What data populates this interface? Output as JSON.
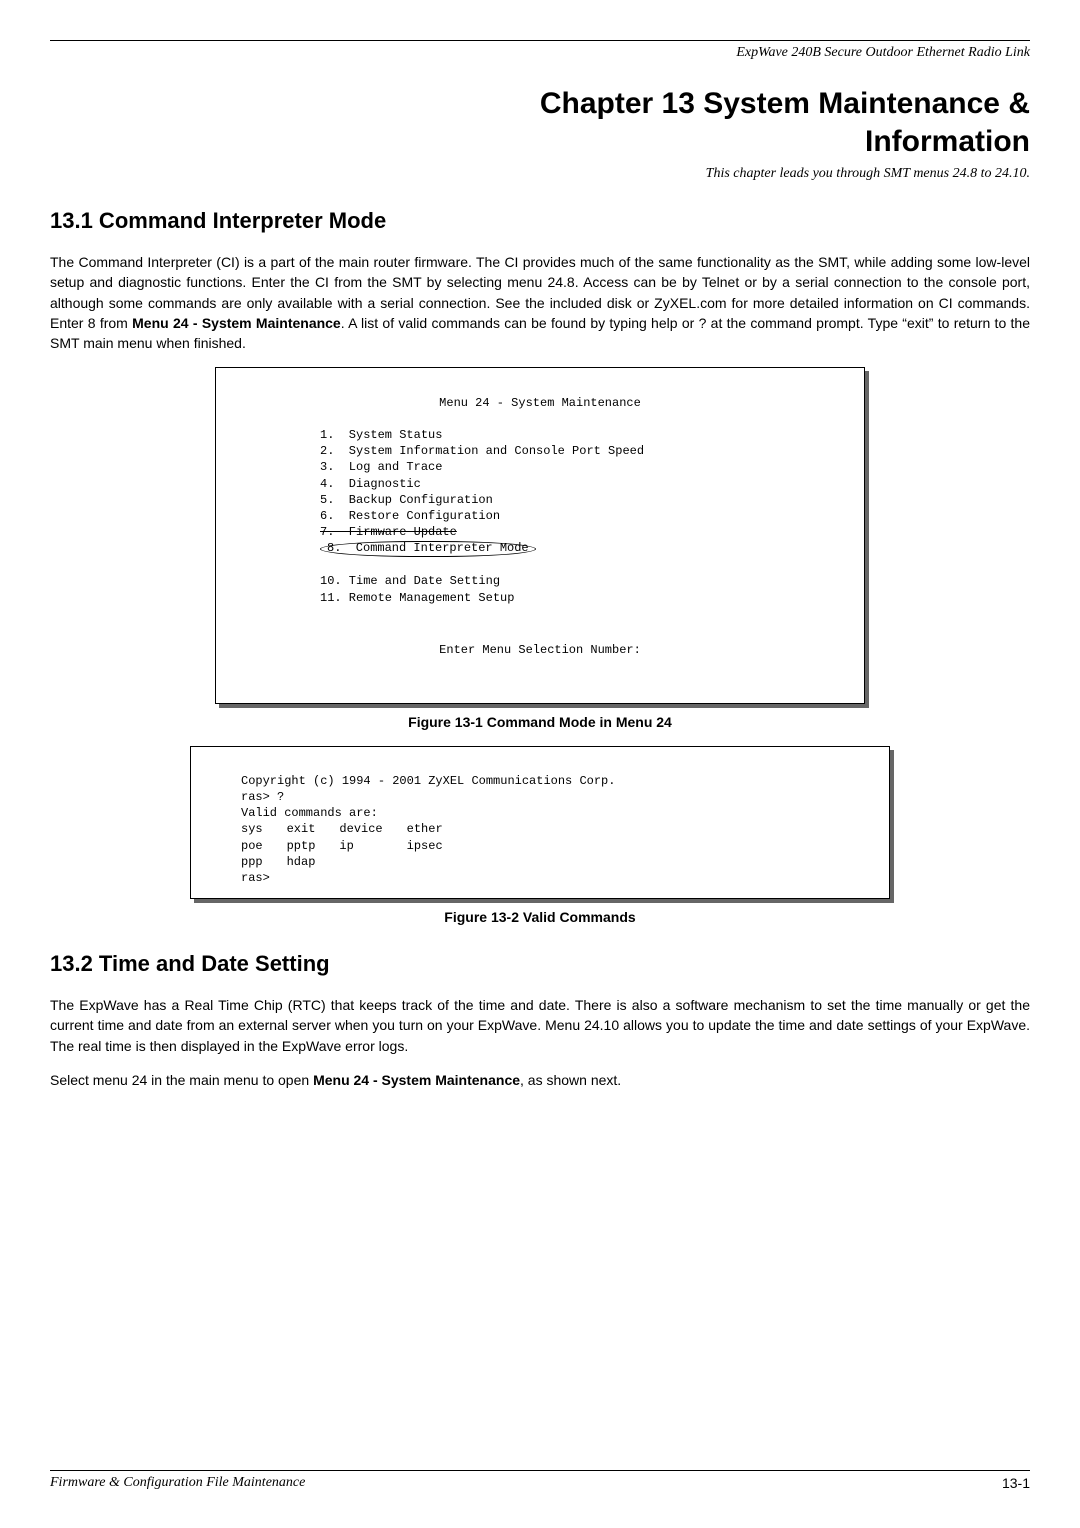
{
  "header": {
    "product": "ExpWave 240B Secure Outdoor Ethernet Radio Link"
  },
  "chapter": {
    "title_line1": "Chapter 13  System Maintenance &",
    "title_line2": "Information",
    "lead": "This chapter leads you through SMT menus 24.8 to 24.10."
  },
  "section1": {
    "heading": "13.1 Command Interpreter Mode",
    "para_pre_bold": "The Command Interpreter (CI) is a part of the main router firmware. The CI provides much of the same functionality as the SMT, while adding some low-level setup and diagnostic functions. Enter the CI from the SMT by selecting menu 24.8. Access can be by Telnet or by a serial connection to the console port, although some commands are only available with a serial connection. See the included disk or ZyXEL.com for more detailed information on CI commands. Enter 8 from ",
    "bold1": "Menu 24 - System Maintenance",
    "para_post_bold": ". A list of valid commands can be found by typing help or ? at the command prompt. Type “exit” to return to the SMT main menu when finished."
  },
  "terminal1": {
    "menu_title": "Menu 24 - System Maintenance",
    "items": {
      "i1": "1.  System Status",
      "i2": "2.  System Information and Console Port Speed",
      "i3": "3.  Log and Trace",
      "i4": "4.  Diagnostic",
      "i5": "5.  Backup Configuration",
      "i6": "6.  Restore Configuration",
      "i7": "7.  Firmware Update",
      "i8": "8.  Command Interpreter Mode",
      "i10": "10. Time and Date Setting",
      "i11": "11. Remote Management Setup"
    },
    "enter": "Enter Menu Selection Number:"
  },
  "caption1": "Figure 13-1 Command Mode in Menu 24",
  "terminal2": {
    "line1": "Copyright (c) 1994 - 2001 ZyXEL Communications Corp.",
    "line2": "ras> ?",
    "line3": "Valid commands are:",
    "row1": {
      "c1": "sys",
      "c2": "exit",
      "c3": "device",
      "c4": "ether"
    },
    "row2": {
      "c1": "poe",
      "c2": "pptp",
      "c3": "ip",
      "c4": "ipsec"
    },
    "row3": {
      "c1": "ppp",
      "c2": "hdap",
      "c3": "",
      "c4": ""
    },
    "line_last": "ras>"
  },
  "caption2": "Figure 13-2 Valid Commands",
  "section2": {
    "heading": "13.2 Time and Date Setting",
    "para1": "The ExpWave has a Real Time Chip (RTC) that keeps track of the time and date. There is also a software mechanism to set the time manually or get the current time and date from an external server when you turn on your ExpWave. Menu 24.10 allows you to update the time and date settings of your ExpWave. The real time is then displayed in the ExpWave error logs.",
    "para2_pre": "Select menu 24 in the main menu to open ",
    "bold2": "Menu 24 - System Maintenance",
    "para2_post": ", as shown next."
  },
  "footer": {
    "left": "Firmware & Configuration File Maintenance",
    "right": "13-1"
  }
}
